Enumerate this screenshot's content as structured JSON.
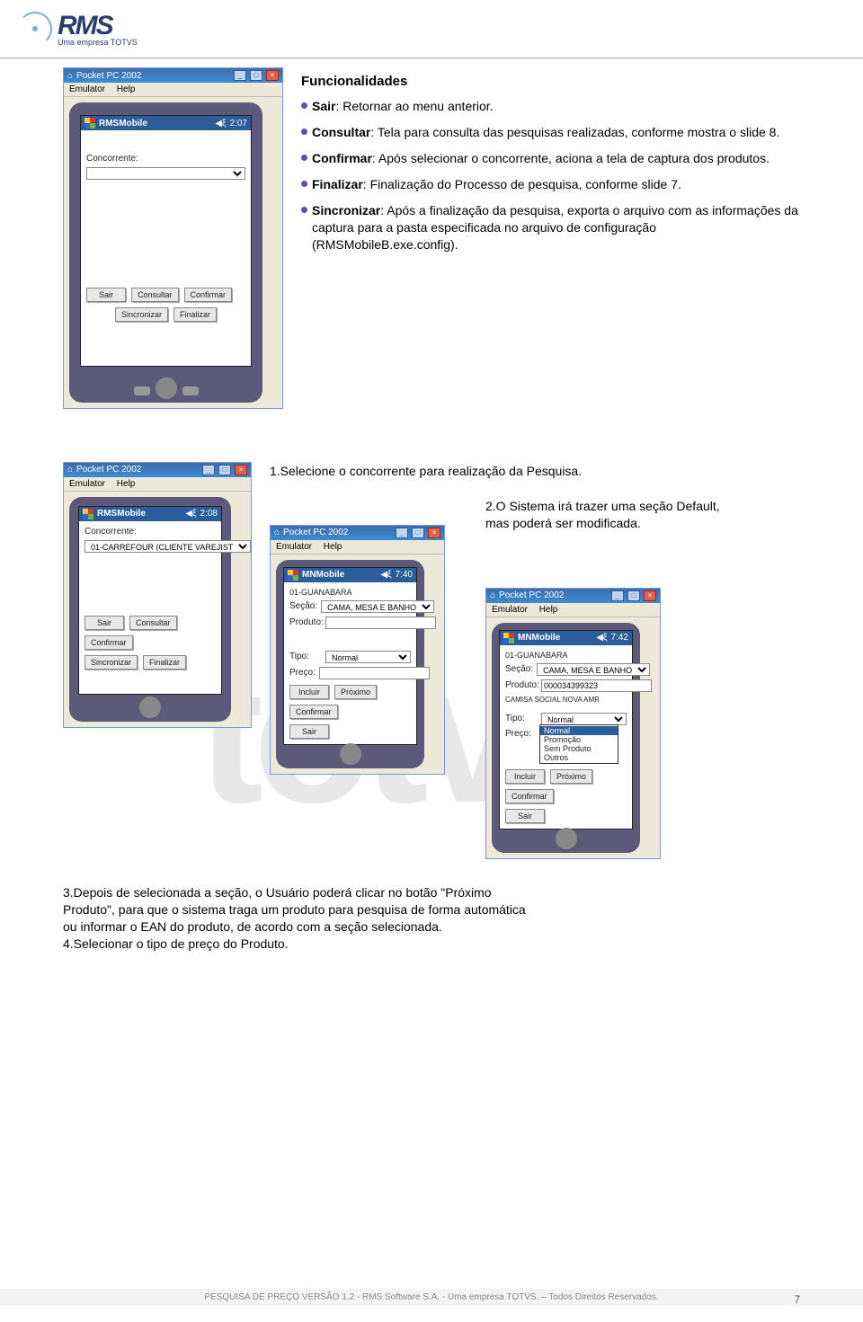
{
  "header": {
    "logo_text": "RMS",
    "logo_sub": "Uma empresa TOTVS"
  },
  "watermark": "totvs",
  "emu": {
    "title": "Pocket PC 2002",
    "menu_emulator": "Emulator",
    "menu_help": "Help"
  },
  "screen1": {
    "app": "RMSMobile",
    "time": "2:07",
    "label_concorrente": "Concorrente:",
    "btn_sair": "Sair",
    "btn_consultar": "Consultar",
    "btn_confirmar": "Confirmar",
    "btn_sincronizar": "Sincronizar",
    "btn_finalizar": "Finalizar"
  },
  "desc1": {
    "title": "Funcionalidades",
    "sair_t": "Sair",
    "sair_d": ": Retornar ao menu anterior.",
    "consultar_t": "Consultar",
    "consultar_d": ": Tela para consulta das pesquisas realizadas, conforme mostra o slide 8.",
    "confirmar_t": "Confirmar",
    "confirmar_d": ": Após selecionar o concorrente, aciona a tela de captura dos produtos.",
    "finalizar_t": "Finalizar",
    "finalizar_d": ": Finalização do Processo de pesquisa, conforme slide 7.",
    "sincronizar_t": "Sincronizar",
    "sincronizar_d": ": Após a finalização da pesquisa, exporta o arquivo com as informações da captura para a pasta especificada no arquivo de configuração (RMSMobileB.exe.config)."
  },
  "step1": "1.Selecione o concorrente para realização da Pesquisa.",
  "screen2": {
    "app": "RMSMobile",
    "time": "2:08",
    "label_concorrente": "Concorrente:",
    "value_concorrente": "01-CARREFOUR (CLIENTE VAREJIST",
    "btn_sair": "Sair",
    "btn_consultar": "Consultar",
    "btn_confirmar": "Confirmar",
    "btn_sincronizar": "Sincronizar",
    "btn_finalizar": "Finalizar"
  },
  "step2": "2.O Sistema irá trazer uma seção Default, mas poderá ser modificada.",
  "screen3": {
    "app": "MNMobile",
    "time": "7:40",
    "header_line": "01-GUANABARA",
    "lbl_secao": "Seção:",
    "val_secao": "CAMA, MESA E BANHO",
    "lbl_produto": "Produto:",
    "lbl_tipo": "Tipo:",
    "val_tipo": "Normal",
    "lbl_preco": "Preço:",
    "btn_incluir": "Incluir",
    "btn_proximo": "Próximo",
    "btn_confirmar": "Confirmar",
    "btn_sair": "Sair"
  },
  "screen4": {
    "app": "MNMobile",
    "time": "7:42",
    "header_line": "01-GUANABARA",
    "lbl_secao": "Seção:",
    "val_secao": "CAMA, MESA E BANHO",
    "lbl_produto": "Produto:",
    "val_produto": "000034399323",
    "prod_desc": "CAMISA SOCIAL NOVA AMR",
    "lbl_tipo": "Tipo:",
    "lbl_preco": "Preço:",
    "dd_sel": "Normal",
    "dd_opts": [
      "Normal",
      "Promoção",
      "Sem Produto",
      "Outros"
    ],
    "btn_incluir": "Incluir",
    "btn_proximo": "Próximo",
    "btn_confirmar": "Confirmar",
    "btn_sair": "Sair"
  },
  "step3": "3.Depois de selecionada a seção, o Usuário poderá clicar no botão \"Próximo Produto\", para que o sistema traga um produto para pesquisa de forma automática ou informar o EAN do produto, de acordo com a seção selecionada.",
  "step4": "4.Selecionar o tipo de preço do Produto.",
  "footer": "PESQUISA DE PREÇO VERSÃO 1.2 - RMS Software S.A.  - Uma empresa TOTVS. – Todos Direitos Reservados.",
  "page_num": "7"
}
